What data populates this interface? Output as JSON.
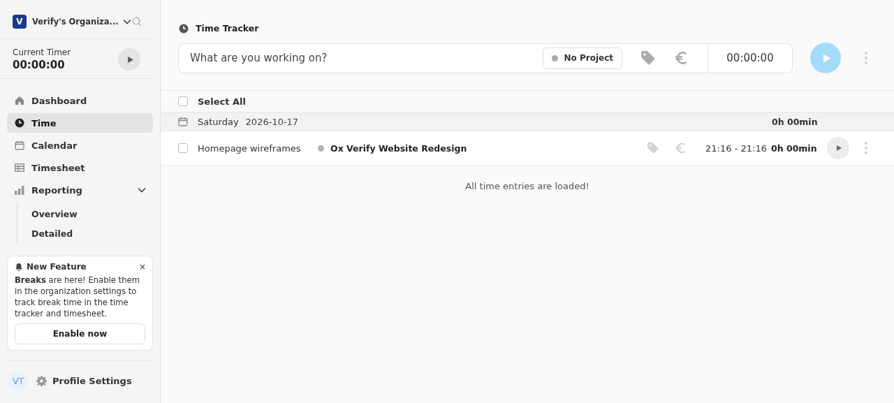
{
  "organization": {
    "initial": "V",
    "name": "Verify's Organiza..."
  },
  "current_timer": {
    "label": "Current Timer",
    "time": "00:00:00"
  },
  "nav": [
    {
      "label": "Dashboard",
      "kind": "home",
      "selected": false
    },
    {
      "label": "Time",
      "kind": "clock",
      "selected": true
    },
    {
      "label": "Calendar",
      "kind": "calendar",
      "selected": false
    },
    {
      "label": "Timesheet",
      "kind": "table",
      "selected": false
    },
    {
      "label": "Reporting",
      "kind": "chart",
      "selected": false,
      "expanded": true,
      "children": [
        {
          "label": "Overview",
          "selected": false
        },
        {
          "label": "Detailed",
          "selected": false
        }
      ]
    }
  ],
  "notice": {
    "title": "New Feature",
    "text": "**Breaks** are here! Enable them in the organization settings to track break time in the time tracker and timesheet.",
    "button": "Enable now"
  },
  "profile": {
    "initials": "VT",
    "label": "Profile Settings"
  },
  "tracker": {
    "title": "Time Tracker",
    "placeholder": "What are you working on?",
    "project": "No Project",
    "duration": "00:00:00"
  },
  "select_all": {
    "label": "Select All",
    "checked": false
  },
  "groups": [
    {
      "day": "Saturday",
      "date": "2026-10-17",
      "total": "0h 00min",
      "entries": [
        {
          "description": "Homepage wireframes",
          "project": "Ox Verify Website Redesign",
          "color": "#b3b3b3",
          "time_range": "21:16 - 21:16",
          "duration": "0h 00min",
          "checked": false
        }
      ]
    }
  ],
  "footer_message": "All time entries are loaded!"
}
